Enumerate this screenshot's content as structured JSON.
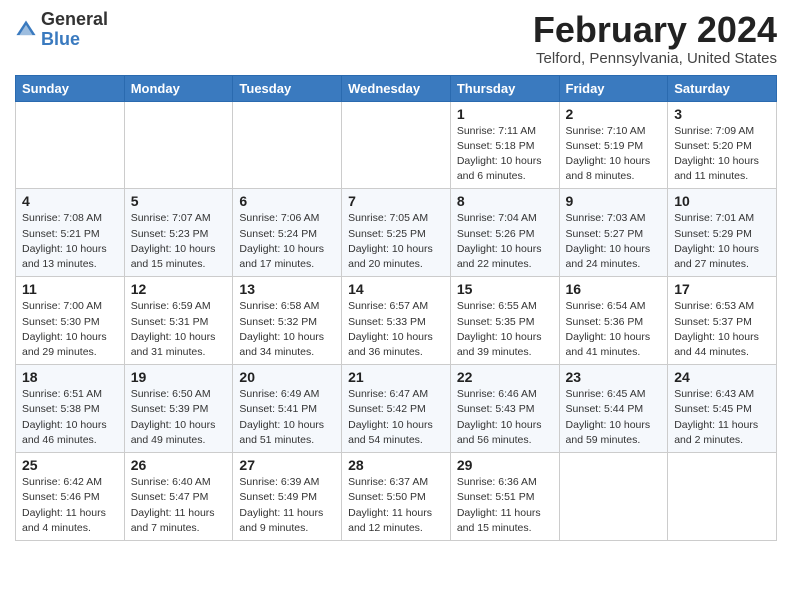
{
  "logo": {
    "general": "General",
    "blue": "Blue"
  },
  "title": "February 2024",
  "location": "Telford, Pennsylvania, United States",
  "days_of_week": [
    "Sunday",
    "Monday",
    "Tuesday",
    "Wednesday",
    "Thursday",
    "Friday",
    "Saturday"
  ],
  "weeks": [
    [
      {
        "day": "",
        "info": ""
      },
      {
        "day": "",
        "info": ""
      },
      {
        "day": "",
        "info": ""
      },
      {
        "day": "",
        "info": ""
      },
      {
        "day": "1",
        "info": "Sunrise: 7:11 AM\nSunset: 5:18 PM\nDaylight: 10 hours\nand 6 minutes."
      },
      {
        "day": "2",
        "info": "Sunrise: 7:10 AM\nSunset: 5:19 PM\nDaylight: 10 hours\nand 8 minutes."
      },
      {
        "day": "3",
        "info": "Sunrise: 7:09 AM\nSunset: 5:20 PM\nDaylight: 10 hours\nand 11 minutes."
      }
    ],
    [
      {
        "day": "4",
        "info": "Sunrise: 7:08 AM\nSunset: 5:21 PM\nDaylight: 10 hours\nand 13 minutes."
      },
      {
        "day": "5",
        "info": "Sunrise: 7:07 AM\nSunset: 5:23 PM\nDaylight: 10 hours\nand 15 minutes."
      },
      {
        "day": "6",
        "info": "Sunrise: 7:06 AM\nSunset: 5:24 PM\nDaylight: 10 hours\nand 17 minutes."
      },
      {
        "day": "7",
        "info": "Sunrise: 7:05 AM\nSunset: 5:25 PM\nDaylight: 10 hours\nand 20 minutes."
      },
      {
        "day": "8",
        "info": "Sunrise: 7:04 AM\nSunset: 5:26 PM\nDaylight: 10 hours\nand 22 minutes."
      },
      {
        "day": "9",
        "info": "Sunrise: 7:03 AM\nSunset: 5:27 PM\nDaylight: 10 hours\nand 24 minutes."
      },
      {
        "day": "10",
        "info": "Sunrise: 7:01 AM\nSunset: 5:29 PM\nDaylight: 10 hours\nand 27 minutes."
      }
    ],
    [
      {
        "day": "11",
        "info": "Sunrise: 7:00 AM\nSunset: 5:30 PM\nDaylight: 10 hours\nand 29 minutes."
      },
      {
        "day": "12",
        "info": "Sunrise: 6:59 AM\nSunset: 5:31 PM\nDaylight: 10 hours\nand 31 minutes."
      },
      {
        "day": "13",
        "info": "Sunrise: 6:58 AM\nSunset: 5:32 PM\nDaylight: 10 hours\nand 34 minutes."
      },
      {
        "day": "14",
        "info": "Sunrise: 6:57 AM\nSunset: 5:33 PM\nDaylight: 10 hours\nand 36 minutes."
      },
      {
        "day": "15",
        "info": "Sunrise: 6:55 AM\nSunset: 5:35 PM\nDaylight: 10 hours\nand 39 minutes."
      },
      {
        "day": "16",
        "info": "Sunrise: 6:54 AM\nSunset: 5:36 PM\nDaylight: 10 hours\nand 41 minutes."
      },
      {
        "day": "17",
        "info": "Sunrise: 6:53 AM\nSunset: 5:37 PM\nDaylight: 10 hours\nand 44 minutes."
      }
    ],
    [
      {
        "day": "18",
        "info": "Sunrise: 6:51 AM\nSunset: 5:38 PM\nDaylight: 10 hours\nand 46 minutes."
      },
      {
        "day": "19",
        "info": "Sunrise: 6:50 AM\nSunset: 5:39 PM\nDaylight: 10 hours\nand 49 minutes."
      },
      {
        "day": "20",
        "info": "Sunrise: 6:49 AM\nSunset: 5:41 PM\nDaylight: 10 hours\nand 51 minutes."
      },
      {
        "day": "21",
        "info": "Sunrise: 6:47 AM\nSunset: 5:42 PM\nDaylight: 10 hours\nand 54 minutes."
      },
      {
        "day": "22",
        "info": "Sunrise: 6:46 AM\nSunset: 5:43 PM\nDaylight: 10 hours\nand 56 minutes."
      },
      {
        "day": "23",
        "info": "Sunrise: 6:45 AM\nSunset: 5:44 PM\nDaylight: 10 hours\nand 59 minutes."
      },
      {
        "day": "24",
        "info": "Sunrise: 6:43 AM\nSunset: 5:45 PM\nDaylight: 11 hours\nand 2 minutes."
      }
    ],
    [
      {
        "day": "25",
        "info": "Sunrise: 6:42 AM\nSunset: 5:46 PM\nDaylight: 11 hours\nand 4 minutes."
      },
      {
        "day": "26",
        "info": "Sunrise: 6:40 AM\nSunset: 5:47 PM\nDaylight: 11 hours\nand 7 minutes."
      },
      {
        "day": "27",
        "info": "Sunrise: 6:39 AM\nSunset: 5:49 PM\nDaylight: 11 hours\nand 9 minutes."
      },
      {
        "day": "28",
        "info": "Sunrise: 6:37 AM\nSunset: 5:50 PM\nDaylight: 11 hours\nand 12 minutes."
      },
      {
        "day": "29",
        "info": "Sunrise: 6:36 AM\nSunset: 5:51 PM\nDaylight: 11 hours\nand 15 minutes."
      },
      {
        "day": "",
        "info": ""
      },
      {
        "day": "",
        "info": ""
      }
    ]
  ]
}
